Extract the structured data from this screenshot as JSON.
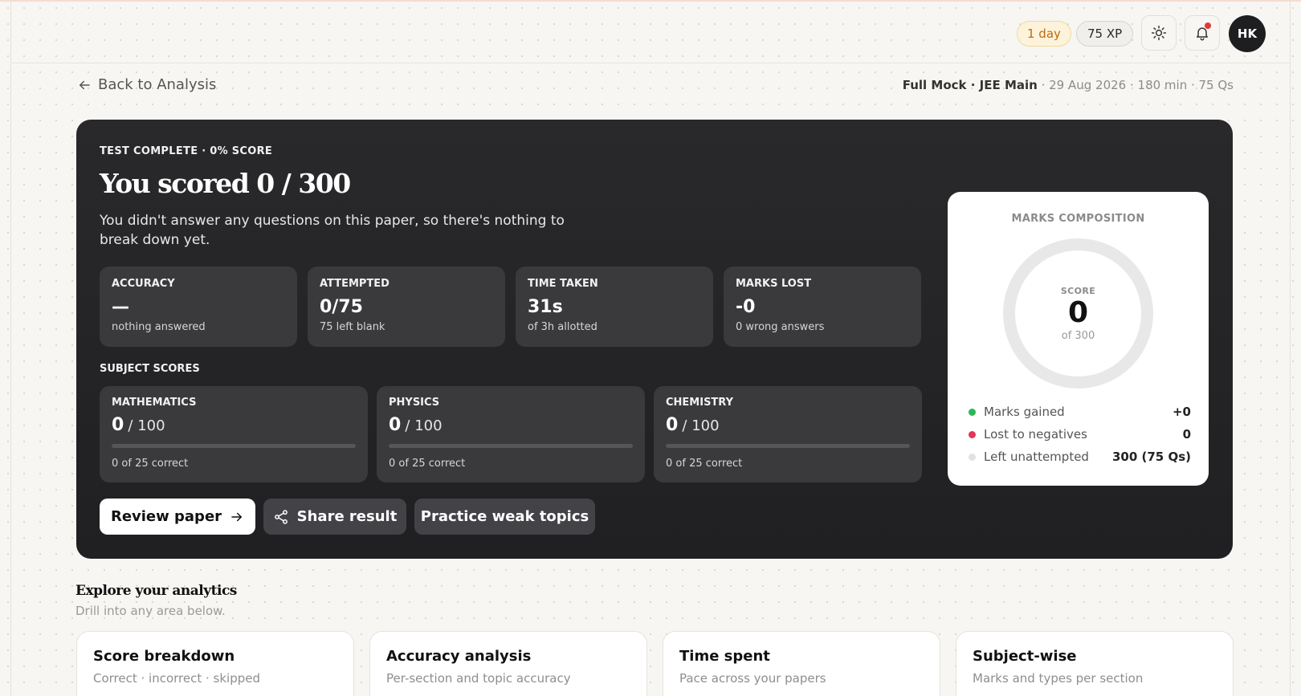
{
  "header": {
    "streak": "1 day",
    "xp": "75 XP",
    "avatar_initials": "HK",
    "icons": [
      "sun-icon",
      "bell-icon"
    ]
  },
  "nav": {
    "back_label": "Back to Analysis",
    "test_name": "Full Mock · JEE Main",
    "test_details": " · 29 Aug 2026 · 180 min · 75 Qs"
  },
  "hero": {
    "eyebrow": "TEST COMPLETE · 0% SCORE",
    "title": "You scored 0 / 300",
    "subtitle": "You didn't answer any questions on this paper, so there's nothing to break down yet.",
    "stats": [
      {
        "label": "ACCURACY",
        "value": "—",
        "note": "nothing answered"
      },
      {
        "label": "ATTEMPTED",
        "value": "0/75",
        "note": "75 left blank"
      },
      {
        "label": "TIME TAKEN",
        "value": "31s",
        "note": "of 3h allotted"
      },
      {
        "label": "MARKS LOST",
        "value": "-0",
        "note": "0 wrong answers"
      }
    ],
    "subject_section_label": "SUBJECT SCORES",
    "subjects": [
      {
        "name": "MATHEMATICS",
        "score": "0",
        "total": "/ 100",
        "progress": 0,
        "note": "0 of 25 correct"
      },
      {
        "name": "PHYSICS",
        "score": "0",
        "total": "/ 100",
        "progress": 0,
        "note": "0 of 25 correct"
      },
      {
        "name": "CHEMISTRY",
        "score": "0",
        "total": "/ 100",
        "progress": 0,
        "note": "0 of 25 correct"
      }
    ],
    "actions": {
      "review": "Review paper",
      "share": "Share result",
      "practice": "Practice weak topics"
    }
  },
  "composition": {
    "title": "MARKS COMPOSITION",
    "ring_label": "SCORE",
    "ring_value": "0",
    "ring_total": "of 300",
    "legend": [
      {
        "name": "Marks gained",
        "value": "+0",
        "color": "#2fb55a"
      },
      {
        "name": "Lost to negatives",
        "value": "0",
        "color": "#e0375a"
      },
      {
        "name": "Left unattempted",
        "value": "300 (75 Qs)",
        "color": "#e2e2e2"
      }
    ]
  },
  "explore": {
    "title": "Explore your analytics",
    "subtitle": "Drill into any area below.",
    "cards": [
      {
        "title": "Score breakdown",
        "subtitle": "Correct · incorrect · skipped"
      },
      {
        "title": "Accuracy analysis",
        "subtitle": "Per-section and topic accuracy"
      },
      {
        "title": "Time spent",
        "subtitle": "Pace across your papers"
      },
      {
        "title": "Subject-wise",
        "subtitle": "Marks and types per section"
      }
    ]
  }
}
